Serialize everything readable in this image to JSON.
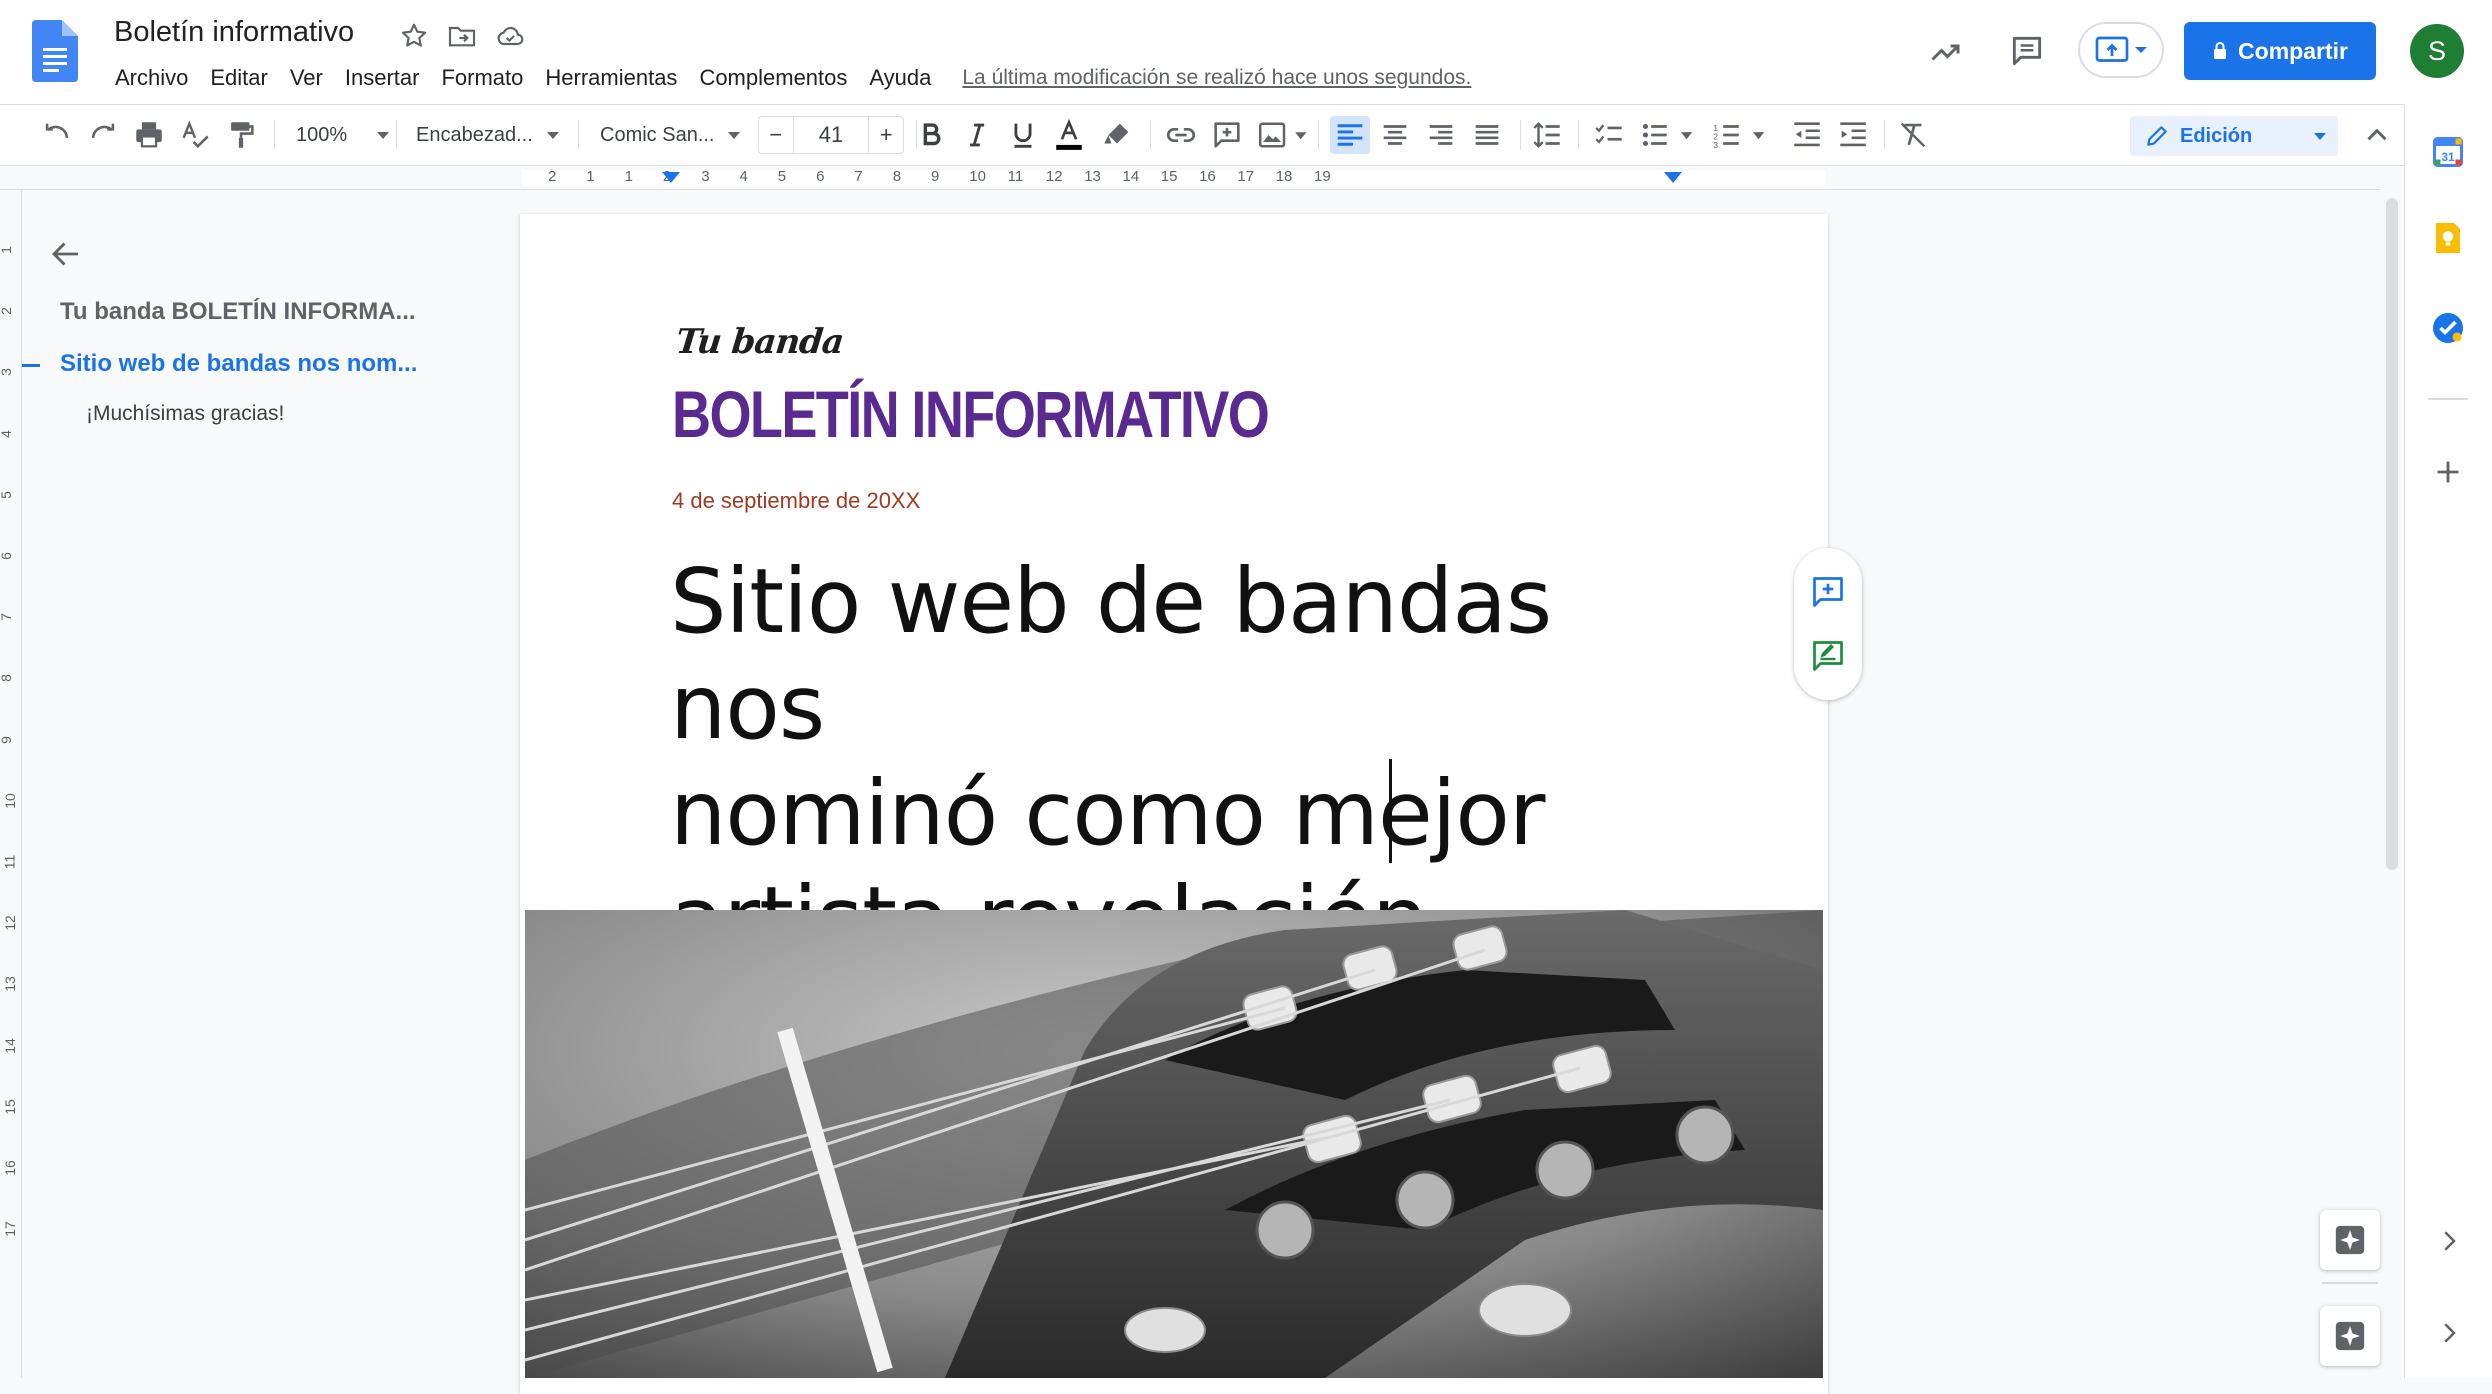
{
  "document": {
    "title": "Boletín informativo",
    "last_edit": "La última modificación se realizó hace unos segundos."
  },
  "menu": [
    "Archivo",
    "Editar",
    "Ver",
    "Insertar",
    "Formato",
    "Herramientas",
    "Complementos",
    "Ayuda"
  ],
  "header": {
    "share_label": "Compartir",
    "avatar_initial": "S"
  },
  "toolbar": {
    "zoom": "100%",
    "style": "Encabezad...",
    "font": "Comic San...",
    "font_size": "41",
    "mode": "Edición"
  },
  "ruler": {
    "marks": [
      "2",
      "1",
      "1",
      "2",
      "3",
      "4",
      "5",
      "6",
      "7",
      "8",
      "9",
      "10",
      "11",
      "12",
      "13",
      "14",
      "15",
      "16",
      "17",
      "18",
      "19"
    ],
    "vmarks": [
      "1",
      "2",
      "3",
      "4",
      "5",
      "6",
      "7",
      "8",
      "9",
      "10",
      "11",
      "12",
      "13",
      "14",
      "15",
      "16",
      "17"
    ]
  },
  "outline": {
    "items": [
      {
        "label": "Tu banda BOLETÍN INFORMA...",
        "level": 1,
        "active": false
      },
      {
        "label": "Sitio web de bandas nos nom...",
        "level": 1,
        "active": true
      },
      {
        "label": "¡Muchísimas gracias!",
        "level": 2,
        "active": false
      }
    ]
  },
  "page": {
    "kicker": "Tu banda",
    "newsletter_title": "BOLETÍN INFORMATIVO",
    "date": "4 de septiembre de 20XX",
    "headline_lines": [
      "Sitio web de bandas nos",
      "nominó como mejor",
      "artista revelación"
    ]
  },
  "colors": {
    "accent": "#1a73e8",
    "newsletter_title": "#5b2a91",
    "date": "#a03a20",
    "avatar": "#1e7e34"
  },
  "icons": [
    "docs-logo-icon",
    "star-icon",
    "move-to-folder-icon",
    "cloud-saved-icon",
    "activity-trend-icon",
    "comments-icon",
    "present-icon",
    "lock-icon",
    "undo-icon",
    "redo-icon",
    "print-icon",
    "spellcheck-icon",
    "paint-format-icon",
    "bold-icon",
    "italic-icon",
    "underline-icon",
    "text-color-icon",
    "highlight-icon",
    "link-icon",
    "add-comment-icon",
    "image-icon",
    "align-left-icon",
    "align-center-icon",
    "align-right-icon",
    "justify-icon",
    "line-spacing-icon",
    "checklist-icon",
    "bulleted-list-icon",
    "numbered-list-icon",
    "decrease-indent-icon",
    "increase-indent-icon",
    "clear-format-icon",
    "pencil-icon",
    "collapse-icon",
    "back-arrow-icon",
    "suggest-edit-icon",
    "calendar-icon",
    "keep-icon",
    "tasks-icon",
    "plus-icon",
    "explore-icon",
    "chevron-right-icon"
  ]
}
